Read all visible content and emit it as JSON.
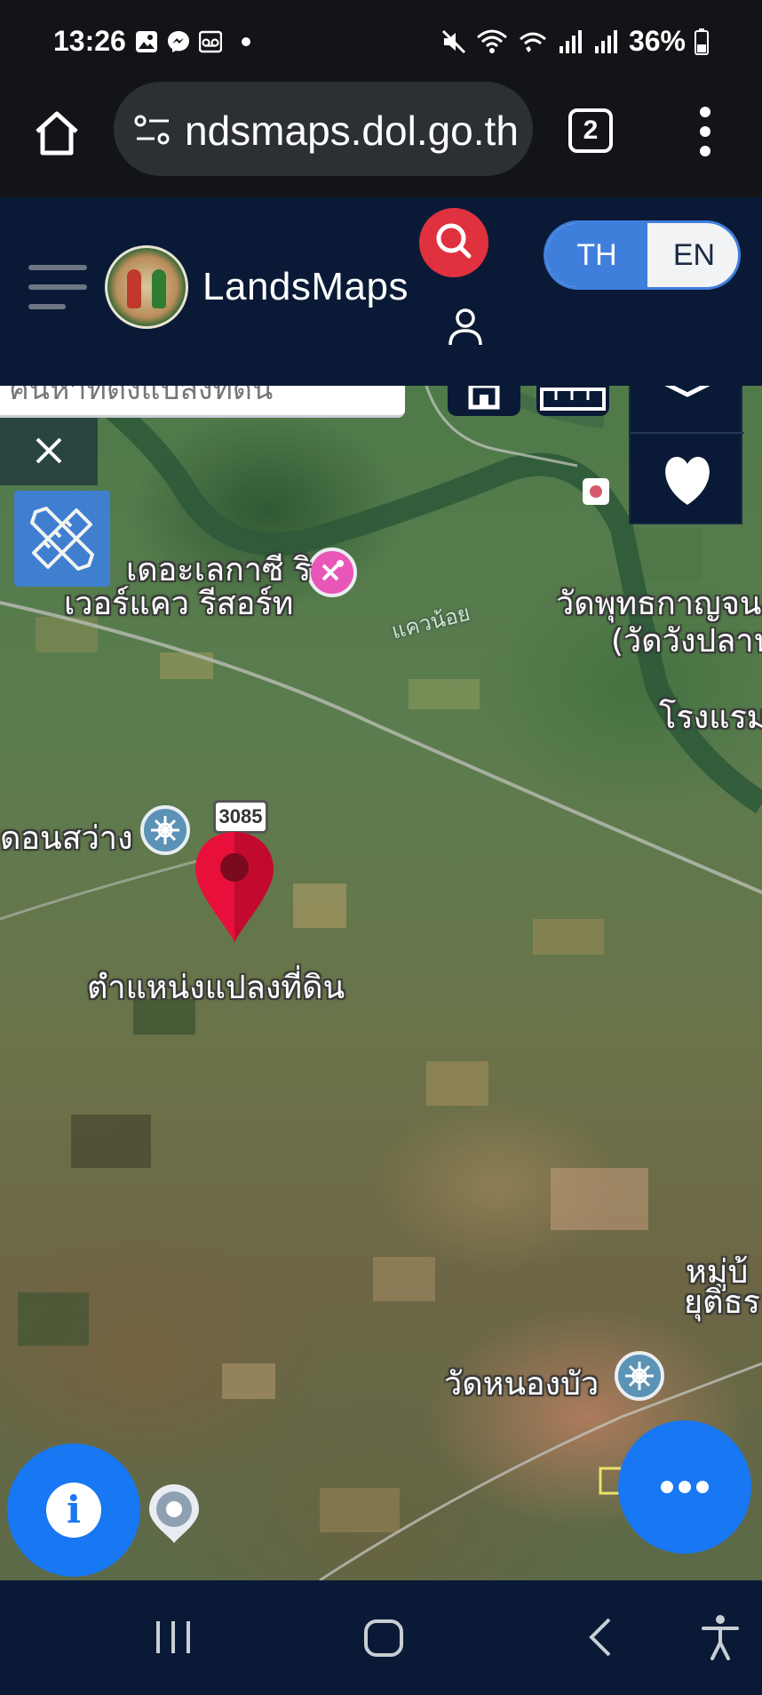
{
  "status_bar": {
    "time": "13:26",
    "battery": "36%",
    "icons_left": [
      "gallery-icon",
      "messenger-icon",
      "voicemail-icon"
    ],
    "icons_right": [
      "mute-icon",
      "wifi-icon",
      "wifi-calling-icon",
      "signal-icon",
      "signal-icon",
      "battery-icon"
    ]
  },
  "browser": {
    "url": "ndsmaps.dol.go.th",
    "tab_count": "2"
  },
  "header": {
    "brand": "LandsMaps",
    "lang_th": "TH",
    "lang_en": "EN",
    "active_lang": "TH"
  },
  "map": {
    "search_partial_text": "ค้นหาที่ตั้งแปลงที่ดิน",
    "labels": {
      "resort": "เดอะเลกาซี ริ",
      "resort2": "เวอร์แคว รีสอร์ท",
      "river": "แควน้อย",
      "temple_ne1": "วัดพุทธกาญจน",
      "temple_ne2": "(วัดวังปลาน",
      "hotel": "โรงแรม",
      "village": "ดอนสว่าง",
      "pin": "ตำแหน่งแปลงที่ดิน",
      "temple_s": "วัดหนองบัว",
      "moo1": "หมู่บ้",
      "moo2": "ยุติธร"
    },
    "route_number": "3085",
    "colors": {
      "pin": "#e8103a",
      "fab": "#1877f2",
      "search": "#e0313f",
      "toggle": "#3f7fdc"
    }
  }
}
